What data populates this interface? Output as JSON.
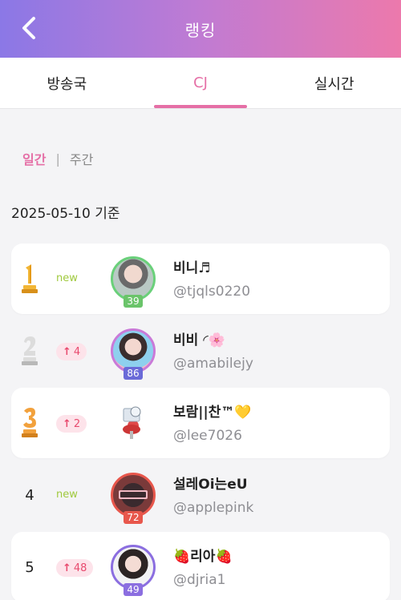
{
  "header": {
    "title": "랭킹"
  },
  "tabs": [
    {
      "label": "방송국",
      "active": false
    },
    {
      "label": "CJ",
      "active": true
    },
    {
      "label": "실시간",
      "active": false
    }
  ],
  "period": {
    "daily": "일간",
    "separator": "|",
    "weekly": "주간"
  },
  "date_label": "2025-05-10 기준",
  "rankings": [
    {
      "rank": "1",
      "change": "new",
      "name": "비니♬",
      "handle": "@tjqls0220",
      "level": "39"
    },
    {
      "rank": "2",
      "change": "4",
      "name": "비비 ◜🌸",
      "handle": "@amabilejy",
      "level": "86"
    },
    {
      "rank": "3",
      "change": "2",
      "name": "보람||찬™💛",
      "handle": "@lee7026",
      "level": ""
    },
    {
      "rank": "4",
      "change": "new",
      "name": "설레Oi는eU",
      "handle": "@applepink",
      "level": "72"
    },
    {
      "rank": "5",
      "change": "48",
      "name": "🍓리아🍓",
      "handle": "@djria1",
      "level": "49"
    }
  ],
  "colors": {
    "accent": "#e56fa6",
    "new": "#9fc93c",
    "up": "#e84a6e"
  }
}
